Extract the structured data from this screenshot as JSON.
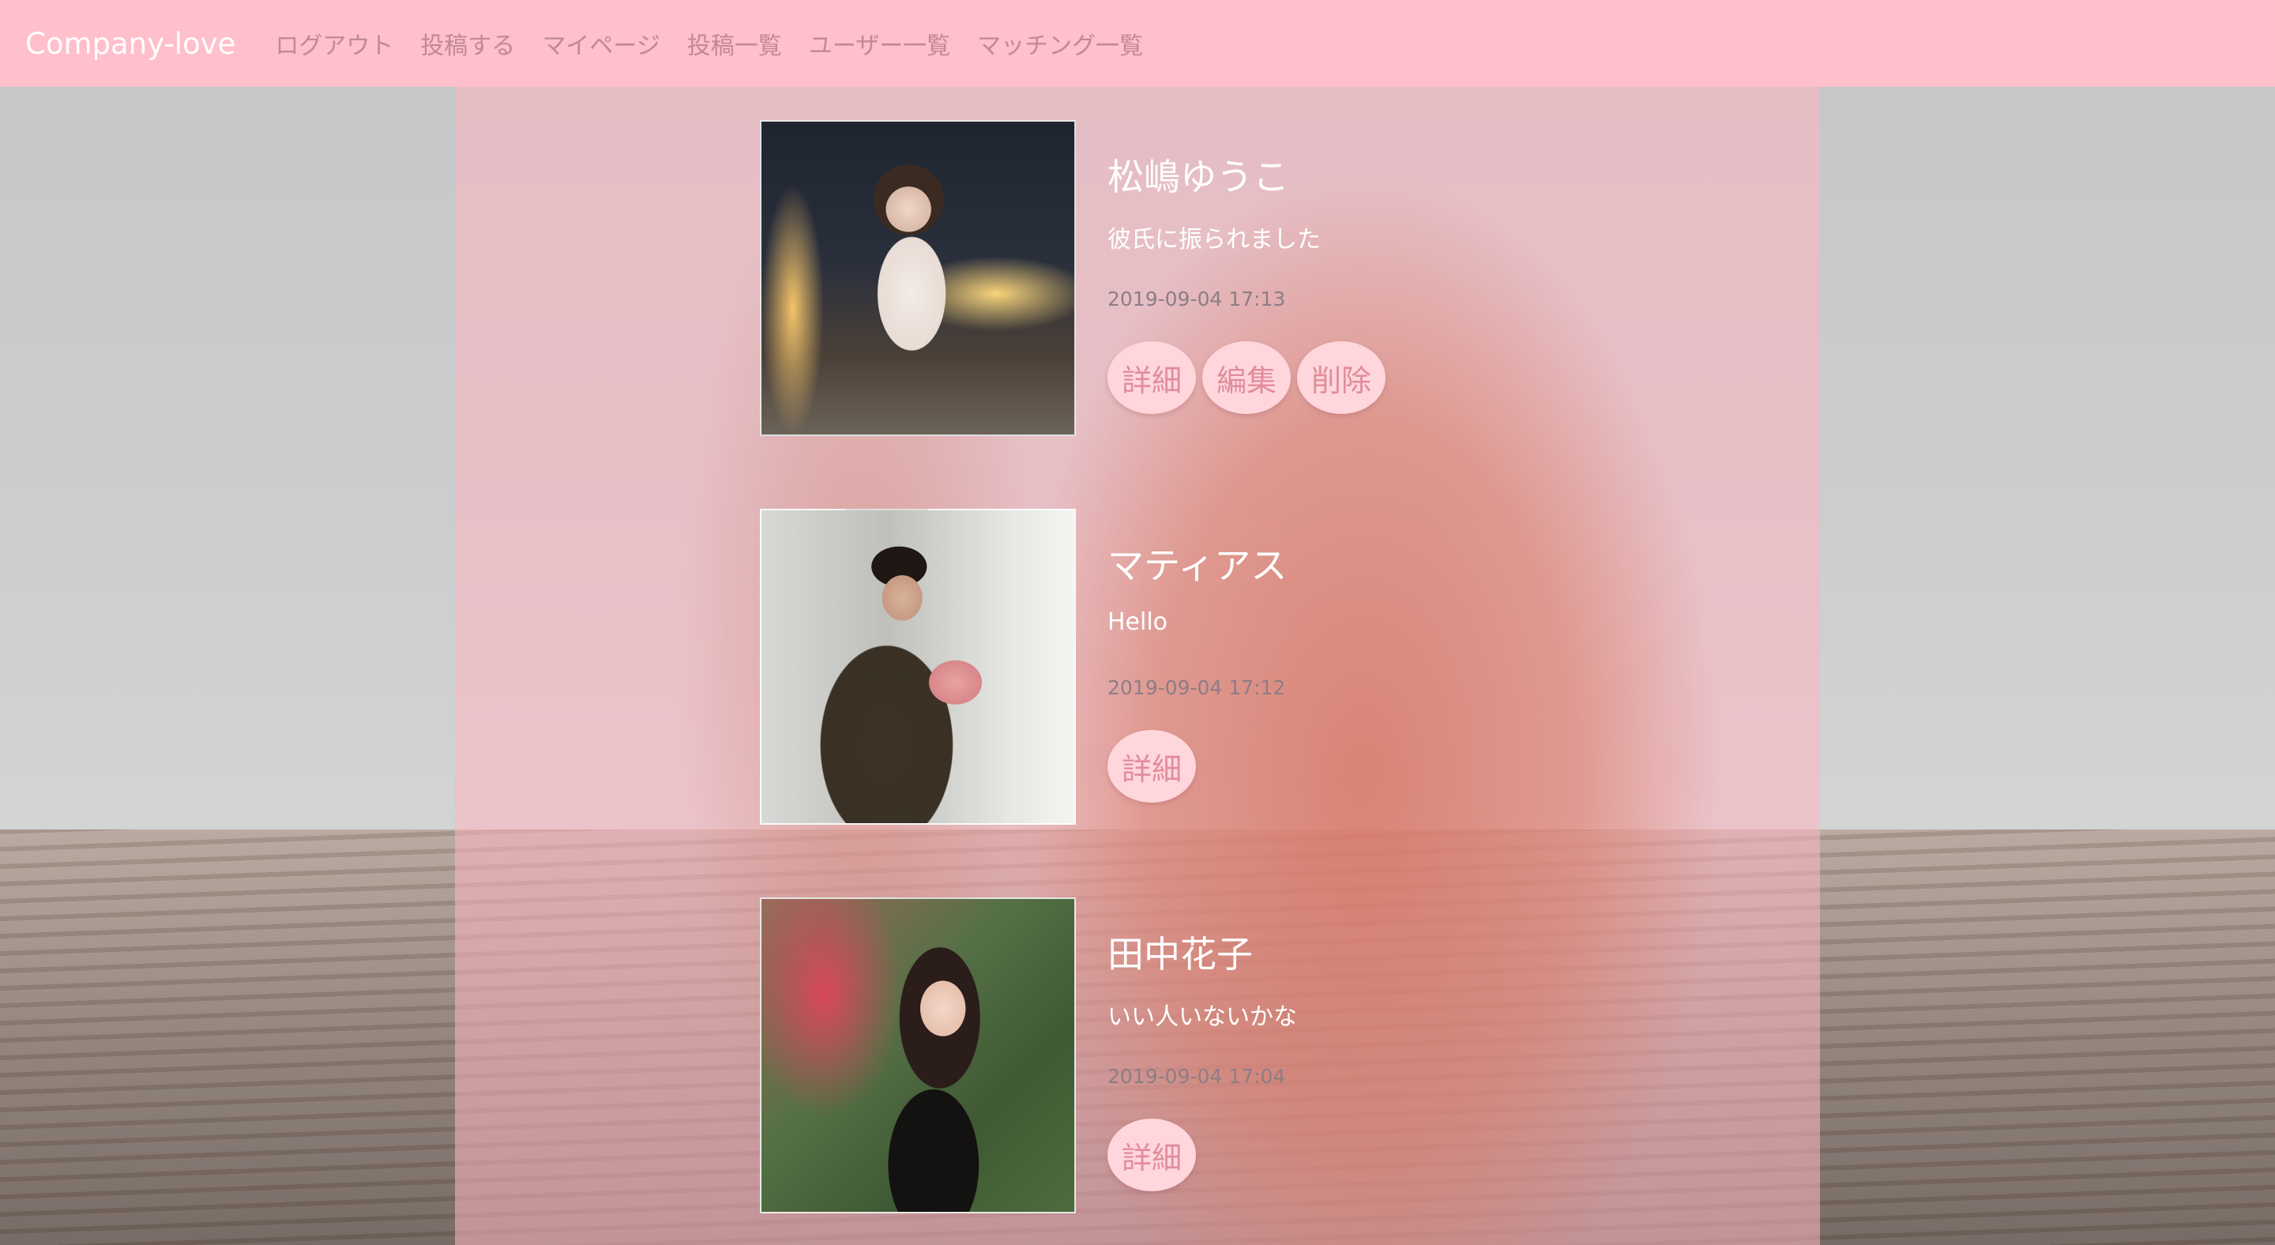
{
  "navbar": {
    "brand": "Company-love",
    "links": [
      "ログアウト",
      "投稿する",
      "マイページ",
      "投稿一覧",
      "ユーザー一覧",
      "マッチング一覧"
    ]
  },
  "posts": [
    {
      "name": "松嶋ゆうこ",
      "text": "彼氏に振られました",
      "date": "2019-09-04 17:13",
      "actions": [
        "詳細",
        "編集",
        "削除"
      ]
    },
    {
      "name": "マティアス",
      "text": "Hello",
      "date": "2019-09-04 17:12",
      "actions": [
        "詳細"
      ]
    },
    {
      "name": "田中花子",
      "text": "いい人いないかな",
      "date": "2019-09-04 17:04",
      "actions": [
        "詳細"
      ]
    }
  ],
  "colors": {
    "navbar_bg": "#ffbfcb",
    "button_bg": "#ffd6dc",
    "button_text": "#e08d9b"
  }
}
